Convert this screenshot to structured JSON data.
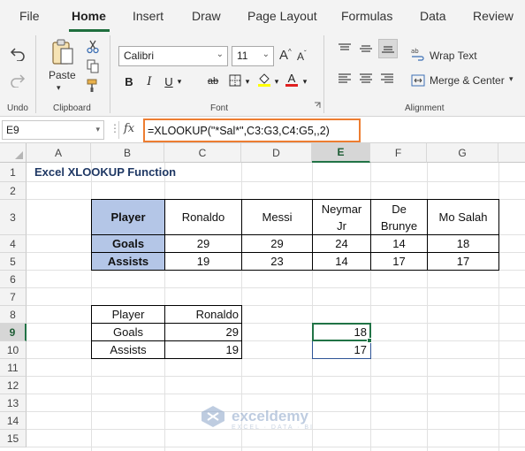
{
  "menu": {
    "tabs": [
      "File",
      "Home",
      "Insert",
      "Draw",
      "Page Layout",
      "Formulas",
      "Data",
      "Review"
    ],
    "active": "Home"
  },
  "ribbon": {
    "undo_label": "Undo",
    "paste_label": "Paste",
    "clipboard_label": "Clipboard",
    "font_name": "Calibri",
    "font_size": "11",
    "bold": "B",
    "italic": "I",
    "underline": "U",
    "strike": "ab",
    "font_label": "Font",
    "grow_font": "A",
    "shrink_font": "A",
    "font_color": "A",
    "wrap_text": "Wrap Text",
    "merge_center": "Merge & Center",
    "alignment_label": "Alignment"
  },
  "formula_bar": {
    "name_box": "E9",
    "fx": "fx",
    "formula": "=XLOOKUP(\"*Sal*\",C3:G3,C4:G5,,2)"
  },
  "columns": [
    "A",
    "B",
    "C",
    "D",
    "E",
    "F",
    "G"
  ],
  "selected_column": "E",
  "rows": [
    "1",
    "2",
    "3",
    "4",
    "5",
    "6",
    "7",
    "8",
    "9",
    "10",
    "11",
    "12",
    "13",
    "14",
    "15"
  ],
  "selected_row": "9",
  "sheet": {
    "title": "Excel XLOOKUP Function",
    "main_table": {
      "header_label": "Player",
      "players": [
        "Ronaldo",
        "Messi",
        "Neymar Jr",
        "De Brunye",
        "Mo Salah"
      ],
      "row_labels": [
        "Goals",
        "Assists"
      ],
      "goals": [
        "29",
        "29",
        "24",
        "14",
        "18"
      ],
      "assists": [
        "19",
        "23",
        "14",
        "17",
        "17"
      ]
    },
    "lookup_table": {
      "labels": [
        "Player",
        "Goals",
        "Assists"
      ],
      "values": [
        "Ronaldo",
        "29",
        "19"
      ]
    },
    "results": [
      "18",
      "17"
    ]
  },
  "watermark": {
    "name": "exceldemy",
    "tagline": "EXCEL · DATA · BI"
  },
  "colors": {
    "accent": "#217346",
    "formula_highlight": "#ed7d31",
    "header_fill": "#b4c6e7",
    "title": "#1f3864"
  }
}
